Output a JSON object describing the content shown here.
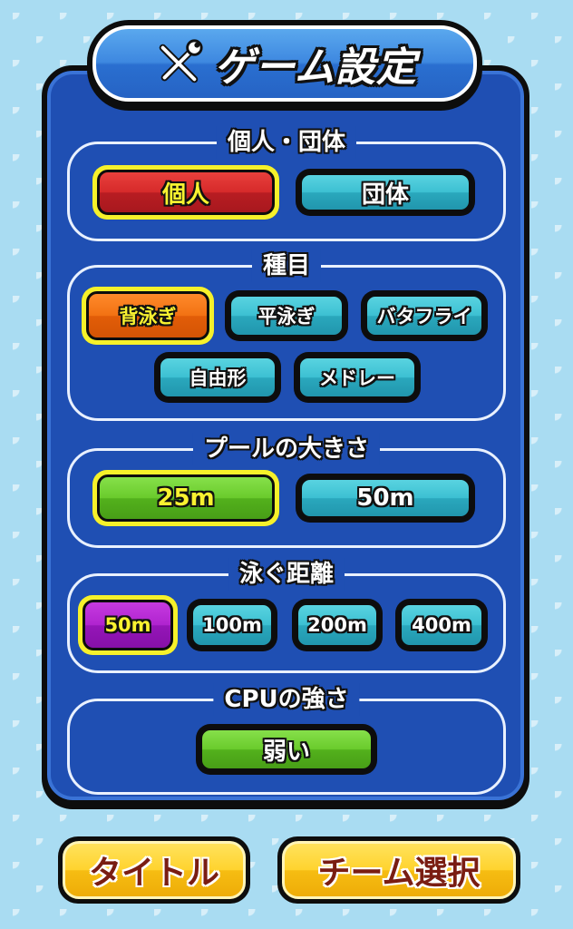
{
  "title": "ゲーム設定",
  "icons": {
    "settings": "wrench-screwdriver-icon"
  },
  "sections": {
    "player_mode": {
      "label": "個人・団体",
      "options": [
        "個人",
        "団体"
      ],
      "selected": "個人"
    },
    "event": {
      "label": "種目",
      "options": [
        "背泳ぎ",
        "平泳ぎ",
        "バタフライ",
        "自由形",
        "メドレー"
      ],
      "selected": "背泳ぎ"
    },
    "pool_size": {
      "label": "プールの大きさ",
      "options": [
        "25m",
        "50m"
      ],
      "selected": "25m"
    },
    "distance": {
      "label": "泳ぐ距離",
      "options": [
        "50m",
        "100m",
        "200m",
        "400m"
      ],
      "selected": "50m"
    },
    "cpu_strength": {
      "label": "CPUの強さ",
      "value": "弱い"
    }
  },
  "buttons": {
    "title": "タイトル",
    "team_select": "チーム選択"
  },
  "colors": {
    "panel": "#1f4fb3",
    "teal": "#3cc0d2",
    "red": "#d62a2a",
    "orange": "#f27213",
    "green": "#6acb2c",
    "purple": "#b024cf",
    "selected_border": "#f6f12a",
    "bottom_button": "#ffd32e"
  }
}
